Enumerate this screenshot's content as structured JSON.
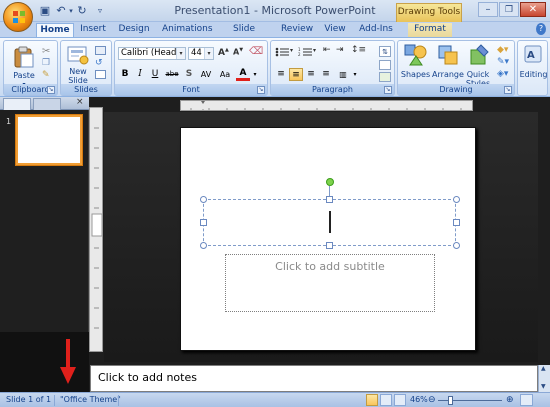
{
  "title_bar": {
    "title": "Presentation1 - Microsoft PowerPoint",
    "contextual_group": "Drawing Tools"
  },
  "tabs": [
    {
      "label": "Home",
      "active": true
    },
    {
      "label": "Insert"
    },
    {
      "label": "Design"
    },
    {
      "label": "Animations"
    },
    {
      "label": "Slide Show"
    },
    {
      "label": "Review"
    },
    {
      "label": "View"
    },
    {
      "label": "Add-Ins"
    },
    {
      "label": "Format",
      "contextual": true
    }
  ],
  "ribbon": {
    "clipboard": {
      "group_label": "Clipboard",
      "paste_label": "Paste"
    },
    "slides": {
      "group_label": "Slides",
      "new_slide_label": "New Slide"
    },
    "font": {
      "group_label": "Font",
      "font_name": "Calibri (Headings",
      "font_size": "44",
      "buttons": [
        "B",
        "I",
        "U",
        "abe",
        "S",
        "AV",
        "Aa",
        "A"
      ]
    },
    "paragraph": {
      "group_label": "Paragraph"
    },
    "drawing": {
      "group_label": "Drawing",
      "shapes_label": "Shapes",
      "arrange_label": "Arrange",
      "quick_styles_label": "Quick Styles"
    },
    "editing": {
      "editing_label": "Editing"
    }
  },
  "thumbnail_pane": {
    "slide_number": "1"
  },
  "slide": {
    "subtitle_placeholder": "Click to add subtitle"
  },
  "notes": {
    "placeholder": "Click to add notes"
  },
  "status_bar": {
    "slide_info": "Slide 1 of 1",
    "theme": "\"Office Theme\"",
    "zoom": "46%",
    "zoom_fraction": 0.46
  },
  "colors": {
    "ribbon_text": "#15428b",
    "selection_orange": "#f19e35",
    "arrow_red": "#e0201b"
  }
}
